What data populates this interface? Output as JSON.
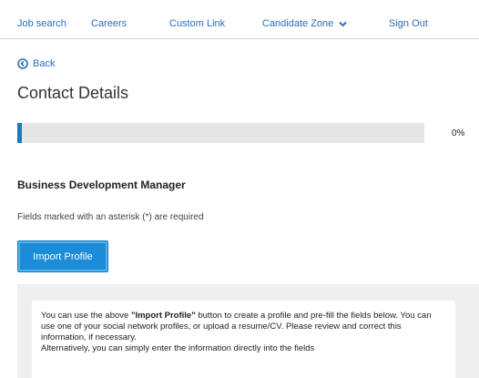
{
  "nav": {
    "items": [
      {
        "label": "Job search"
      },
      {
        "label": "Careers"
      },
      {
        "label": "Custom Link"
      },
      {
        "label": "Candidate Zone"
      },
      {
        "label": "Sign Out"
      }
    ]
  },
  "back": {
    "label": "Back"
  },
  "page": {
    "title": "Contact Details"
  },
  "progress": {
    "value": 0,
    "label": "0%"
  },
  "job": {
    "title": "Business Development Manager"
  },
  "form": {
    "required_note": "Fields marked with an asterisk (*) are required",
    "import_button": "Import Profile"
  },
  "info": {
    "p1_before": "You can use the above ",
    "p1_bold": "\"Import Profile\"",
    "p1_after": " button to create a profile and pre-fill the fields below. You can use one of your social network profiles, or upload a resume/CV. Please review and correct this information, if necessary.",
    "p2": "Alternatively, you can simply enter the information directly into the fields"
  },
  "colors": {
    "accent": "#1a8cd8",
    "link": "#2a6ebb"
  }
}
